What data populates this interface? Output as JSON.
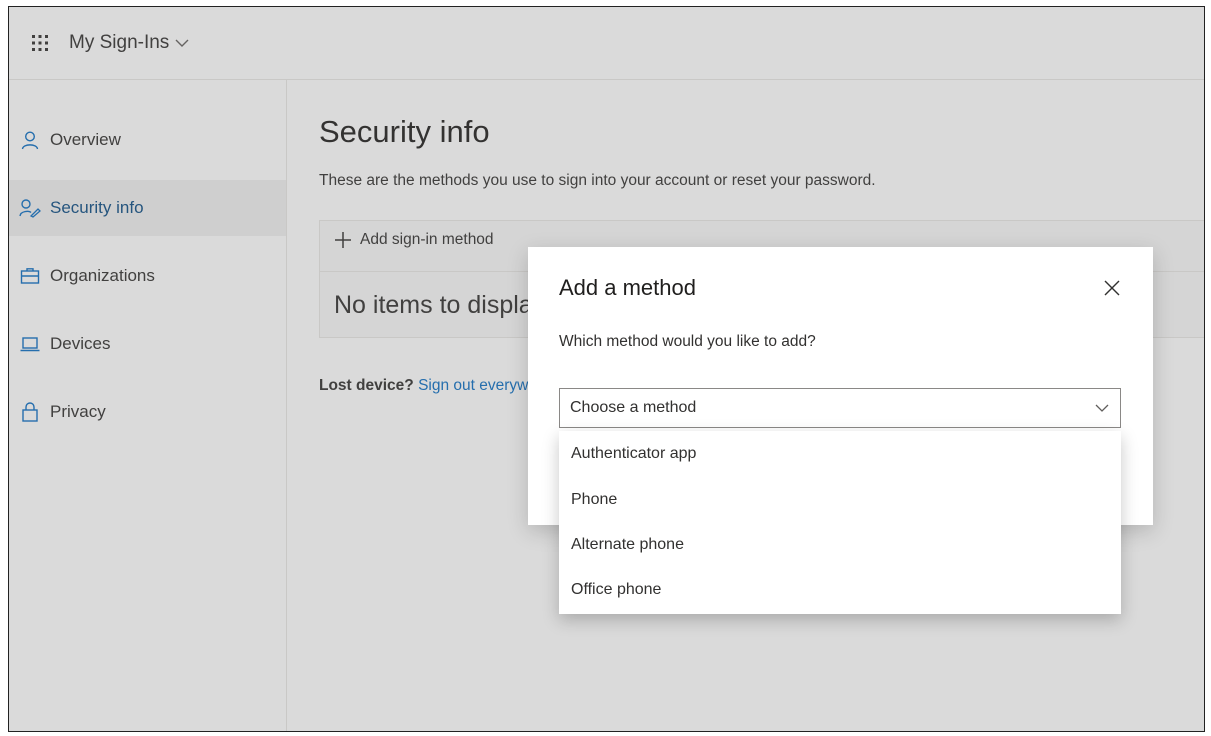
{
  "header": {
    "app_title": "My Sign-Ins"
  },
  "sidebar": {
    "items": [
      {
        "label": "Overview",
        "icon": "person-icon"
      },
      {
        "label": "Security info",
        "icon": "security-info-icon",
        "active": true
      },
      {
        "label": "Organizations",
        "icon": "briefcase-icon"
      },
      {
        "label": "Devices",
        "icon": "laptop-icon"
      },
      {
        "label": "Privacy",
        "icon": "lock-icon"
      }
    ]
  },
  "main": {
    "title": "Security info",
    "description": "These are the methods you use to sign into your account or reset your password.",
    "add_method_label": "Add sign-in method",
    "empty_text": "No items to display.",
    "lost_device_label": "Lost device?",
    "sign_out_link": "Sign out everywhere"
  },
  "dialog": {
    "title": "Add a method",
    "question": "Which method would you like to add?",
    "select_placeholder": "Choose a method",
    "options": [
      "Authenticator app",
      "Phone",
      "Alternate phone",
      "Office phone"
    ]
  },
  "colors": {
    "accent": "#0f6cbd",
    "active_nav_text": "#0f4c81",
    "active_nav_bg": "#e8e8e8"
  }
}
